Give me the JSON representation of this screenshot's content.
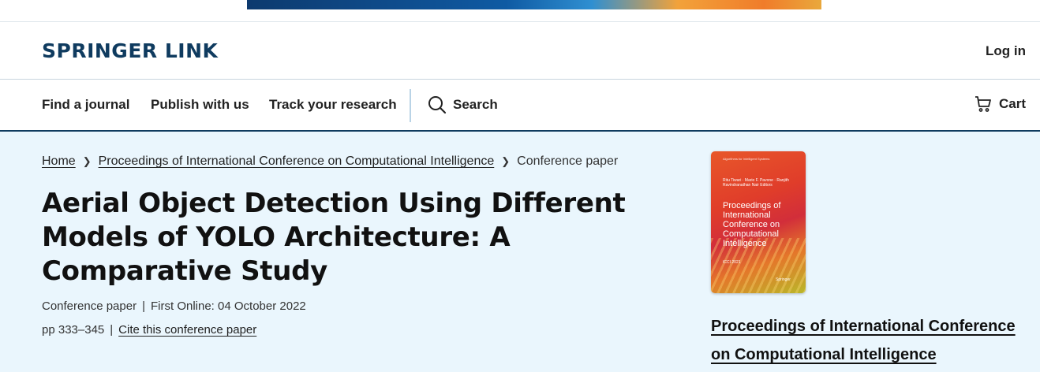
{
  "header": {
    "logo": "SPRINGER LINK",
    "login": "Log in"
  },
  "nav": {
    "find_journal": "Find a journal",
    "publish": "Publish with us",
    "track": "Track your research",
    "search": "Search",
    "cart": "Cart"
  },
  "breadcrumb": {
    "home": "Home",
    "proceedings": "Proceedings of International Conference on Computational Intelligence",
    "current": "Conference paper"
  },
  "article": {
    "title": "Aerial Object Detection Using Different Models of YOLO Architecture: A Comparative Study",
    "type": "Conference paper",
    "first_online": "First Online: 04 October 2022",
    "pages": "pp 333–345",
    "cite": "Cite this conference paper"
  },
  "book": {
    "cover_series": "Algorithms for Intelligent Systems",
    "cover_editors": "Ritu Tiwari · Mario F. Pavone · Ranjith Ravindranathan Nair Editors",
    "cover_title": "Proceedings of International Conference on Computational Intelligence",
    "cover_year": "ICCI 2021",
    "cover_publisher": "Springer",
    "link": "Proceedings of International Conference on Computational Intelligence"
  }
}
